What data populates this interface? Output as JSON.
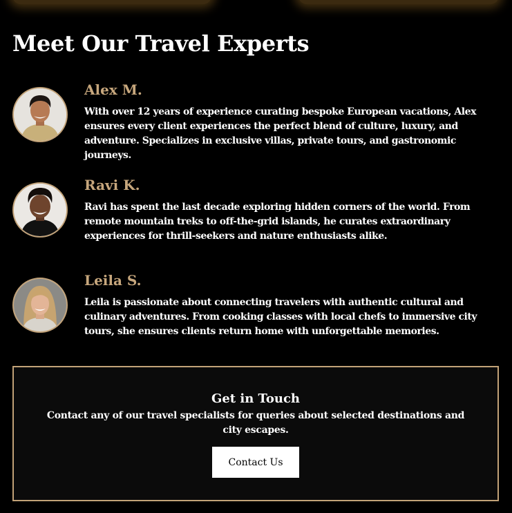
{
  "section": {
    "title": "Meet Our Travel Experts"
  },
  "experts": [
    {
      "name": "Alex M.",
      "bio": "With over 12 years of experience curating bespoke European vacations, Alex ensures every client experiences the perfect blend of culture, luxury, and adventure. Specializes in exclusive villas, private tours, and gastronomic journeys."
    },
    {
      "name": "Ravi K.",
      "bio": "Ravi has spent the last decade exploring hidden corners of the world. From remote mountain treks to off-the-grid islands, he curates extraordinary experiences for thrill-seekers and nature enthusiasts alike."
    },
    {
      "name": "Leila S.",
      "bio": "Leila is passionate about connecting travelers with authentic cultural and culinary adventures. From cooking classes with local chefs to immersive city tours, she ensures clients return home with unforgettable memories."
    }
  ],
  "contact": {
    "title": "Get in Touch",
    "text": "Contact any of our travel specialists for queries about selected destinations and city escapes.",
    "button_label": "Contact Us"
  },
  "colors": {
    "background": "#000000",
    "accent_gold": "#c7a77d",
    "border_gold": "#c2a278",
    "text": "#ffffff"
  }
}
